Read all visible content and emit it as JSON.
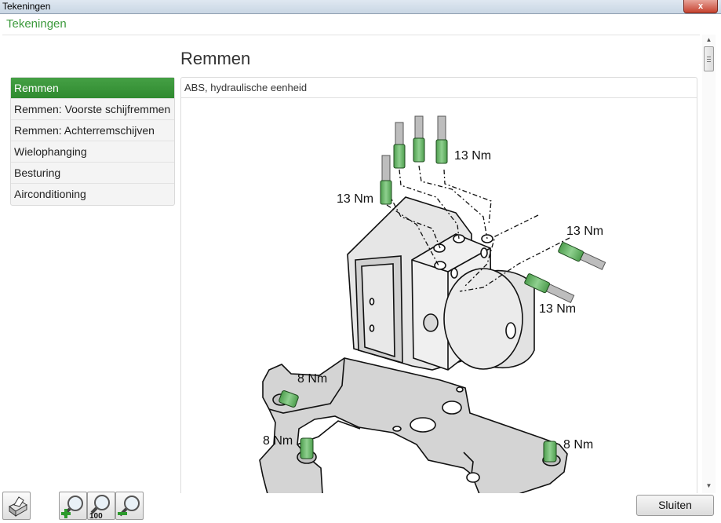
{
  "window": {
    "title": "Tekeningen",
    "close_glyph": "x"
  },
  "header": {
    "title": "Tekeningen"
  },
  "page": {
    "title": "Remmen"
  },
  "nav": {
    "items": [
      {
        "label": "Remmen",
        "active": true
      },
      {
        "label": "Remmen: Voorste schijfremmen",
        "active": false
      },
      {
        "label": "Remmen: Achterremschijven",
        "active": false
      },
      {
        "label": "Wielophanging",
        "active": false
      },
      {
        "label": "Besturing",
        "active": false
      },
      {
        "label": "Airconditioning",
        "active": false
      }
    ]
  },
  "panel": {
    "heading": "ABS, hydraulische eenheid"
  },
  "drawing": {
    "labels": [
      "13 Nm",
      "13 Nm",
      "13 Nm",
      "13 Nm",
      "8 Nm",
      "8 Nm",
      "8 Nm"
    ]
  },
  "toolbar": {
    "icons": [
      "print-icon",
      "zoom-in-icon",
      "zoom-100-icon",
      "zoom-out-icon"
    ],
    "zoom_100_label": "100",
    "close_label": "Sluiten"
  },
  "colors": {
    "accent": "#3d9a3d",
    "active_bg": "#3a963a",
    "part_green": "#6dbb6d"
  }
}
